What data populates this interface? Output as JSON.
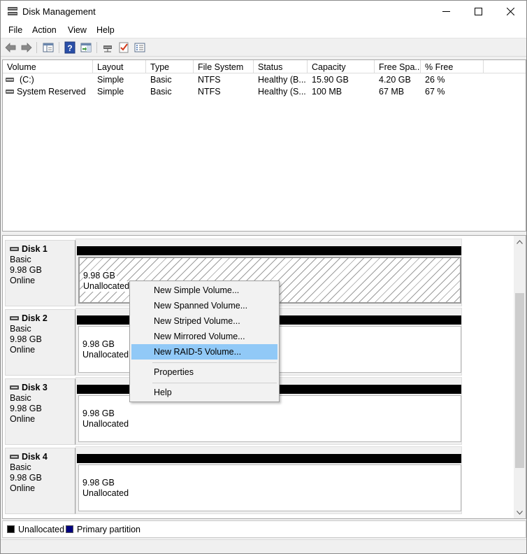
{
  "window": {
    "title": "Disk Management",
    "minimize": "—",
    "maximize": "☐",
    "close": "✕"
  },
  "menu": [
    "File",
    "Action",
    "View",
    "Help"
  ],
  "volume_list": {
    "columns": [
      "Volume",
      "Layout",
      "Type",
      "File System",
      "Status",
      "Capacity",
      "Free Spa...",
      "% Free"
    ],
    "rows": [
      [
        "(C:)",
        "Simple",
        "Basic",
        "NTFS",
        "Healthy (B...",
        "15.90 GB",
        "4.20 GB",
        "26 %"
      ],
      [
        "System Reserved",
        "Simple",
        "Basic",
        "NTFS",
        "Healthy (S...",
        "100 MB",
        "67 MB",
        "67 %"
      ]
    ]
  },
  "disks": [
    {
      "name": "Disk 1",
      "type": "Basic",
      "size": "9.98 GB",
      "state": "Online",
      "part_size": "9.98 GB",
      "part_label": "Unallocated"
    },
    {
      "name": "Disk 2",
      "type": "Basic",
      "size": "9.98 GB",
      "state": "Online",
      "part_size": "9.98 GB",
      "part_label": "Unallocated"
    },
    {
      "name": "Disk 3",
      "type": "Basic",
      "size": "9.98 GB",
      "state": "Online",
      "part_size": "9.98 GB",
      "part_label": "Unallocated"
    },
    {
      "name": "Disk 4",
      "type": "Basic",
      "size": "9.98 GB",
      "state": "Online",
      "part_size": "9.98 GB",
      "part_label": "Unallocated"
    }
  ],
  "legend": [
    {
      "label": "Unallocated",
      "color": "#000000"
    },
    {
      "label": "Primary partition",
      "color": "#00007f"
    }
  ],
  "context_menu": {
    "items": [
      "New Simple Volume...",
      "New Spanned Volume...",
      "New Striped Volume...",
      "New Mirrored Volume...",
      "New RAID-5 Volume..."
    ],
    "highlighted": "New RAID-5 Volume...",
    "properties": "Properties",
    "help": "Help"
  },
  "icons": [
    "disk-management-icon",
    "back-arrow-icon",
    "forward-arrow-icon",
    "console-tree-icon",
    "help-icon",
    "action-pane-icon",
    "connect-icon",
    "checklist-icon",
    "properties-icon"
  ]
}
